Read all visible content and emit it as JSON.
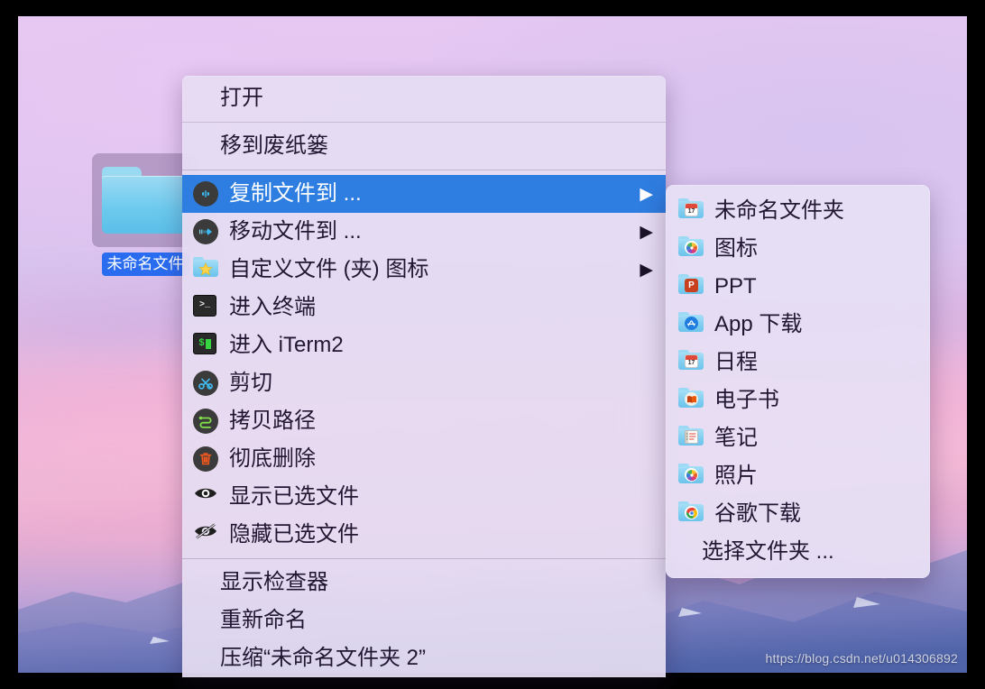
{
  "desktop": {
    "folder": {
      "icon": "blue-folder-icon",
      "label": "未命名文件",
      "selected": true
    },
    "watermark": "https://blog.csdn.net/u014306892"
  },
  "context_menu": {
    "selected_index": 2,
    "groups": [
      {
        "items": [
          {
            "label": "打开",
            "icon": null,
            "submenu": false
          }
        ]
      },
      {
        "items": [
          {
            "label": "移到废纸篓",
            "icon": null,
            "submenu": false
          }
        ]
      },
      {
        "items": [
          {
            "label": "复制文件到 ...",
            "icon": "copy-to-icon",
            "submenu": true,
            "selected": true
          },
          {
            "label": "移动文件到 ...",
            "icon": "move-to-icon",
            "submenu": true
          },
          {
            "label": "自定义文件 (夹) 图标",
            "icon": "star-folder-icon",
            "submenu": true
          },
          {
            "label": "进入终端",
            "icon": "terminal-icon",
            "submenu": false
          },
          {
            "label": "进入 iTerm2",
            "icon": "iterm2-icon",
            "submenu": false
          },
          {
            "label": "剪切",
            "icon": "scissors-icon",
            "submenu": false
          },
          {
            "label": "拷贝路径",
            "icon": "path-icon",
            "submenu": false
          },
          {
            "label": "彻底删除",
            "icon": "trash-icon",
            "submenu": false
          },
          {
            "label": "显示已选文件",
            "icon": "eye-icon",
            "submenu": false
          },
          {
            "label": "隐藏已选文件",
            "icon": "eye-slash-icon",
            "submenu": false
          }
        ]
      },
      {
        "items": [
          {
            "label": "显示检查器",
            "icon": null,
            "submenu": false
          },
          {
            "label": "重新命名",
            "icon": null,
            "submenu": false
          },
          {
            "label": "压缩“未命名文件夹 2”",
            "icon": null,
            "submenu": false
          }
        ]
      }
    ]
  },
  "submenu": {
    "title": "复制文件到",
    "items": [
      {
        "label": "未命名文件夹",
        "icon": "folder-calendar-icon"
      },
      {
        "label": "图标",
        "icon": "folder-photos-icon"
      },
      {
        "label": "PPT",
        "icon": "folder-powerpoint-icon"
      },
      {
        "label": "App 下载",
        "icon": "folder-appstore-icon"
      },
      {
        "label": "日程",
        "icon": "folder-calendar-icon"
      },
      {
        "label": "电子书",
        "icon": "folder-books-icon"
      },
      {
        "label": "笔记",
        "icon": "folder-notes-icon"
      },
      {
        "label": "照片",
        "icon": "folder-photos-icon"
      },
      {
        "label": "谷歌下载",
        "icon": "folder-chrome-icon"
      },
      {
        "label": "选择文件夹 ...",
        "icon": null
      }
    ]
  },
  "colors": {
    "highlight": "#2e7de0",
    "menu_bg": "#e5ddf2",
    "submenu_bg": "#e7dff4",
    "label_selection": "#2a6cf0",
    "text": "#221733"
  },
  "glyphs": {
    "submenu_arrow": "▶"
  }
}
